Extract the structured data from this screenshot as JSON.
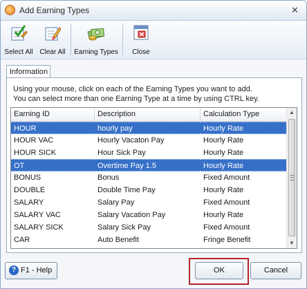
{
  "window": {
    "title": "Add Earning Types",
    "close_glyph": "✕"
  },
  "toolbar": {
    "select_all": "Select All",
    "clear_all": "Clear All",
    "earning_types": "Earning Types",
    "close": "Close"
  },
  "tabs": [
    {
      "label": "Information",
      "active": true
    }
  ],
  "instructions": {
    "line1": "Using your mouse, click on each of the Earning Types you want to add.",
    "line2": "You can select more than one Earning Type at a time by using CTRL key."
  },
  "grid": {
    "columns": [
      "Earning ID",
      "Description",
      "Calculation Type"
    ],
    "rows": [
      {
        "id": "HOUR",
        "description": "hourly pay",
        "calc": "Hourly Rate",
        "selected": true
      },
      {
        "id": "HOUR VAC",
        "description": "Hourly Vacaton Pay",
        "calc": "Hourly Rate",
        "selected": false
      },
      {
        "id": "HOUR SICK",
        "description": "Hour Sick Pay",
        "calc": "Hourly Rate",
        "selected": false
      },
      {
        "id": "OT",
        "description": "Overtime Pay 1.5",
        "calc": "Hourly Rate",
        "selected": true
      },
      {
        "id": "BONUS",
        "description": "Bonus",
        "calc": "Fixed Amount",
        "selected": false
      },
      {
        "id": "DOUBLE",
        "description": "Double Time Pay",
        "calc": "Hourly Rate",
        "selected": false
      },
      {
        "id": "SALARY",
        "description": "Salary Pay",
        "calc": "Fixed Amount",
        "selected": false
      },
      {
        "id": "SALARY VAC",
        "description": "Salary Vacation Pay",
        "calc": "Hourly Rate",
        "selected": false
      },
      {
        "id": "SALARY SICK",
        "description": "Salary Sick Pay",
        "calc": "Fixed Amount",
        "selected": false
      },
      {
        "id": "CAR",
        "description": "Auto Benefit",
        "calc": "Fringe Benefit",
        "selected": false
      }
    ]
  },
  "footer": {
    "help": "F1 - Help",
    "ok": "OK",
    "cancel": "Cancel"
  },
  "colors": {
    "selection": "#3670c8",
    "highlight_box": "#b4232a"
  }
}
